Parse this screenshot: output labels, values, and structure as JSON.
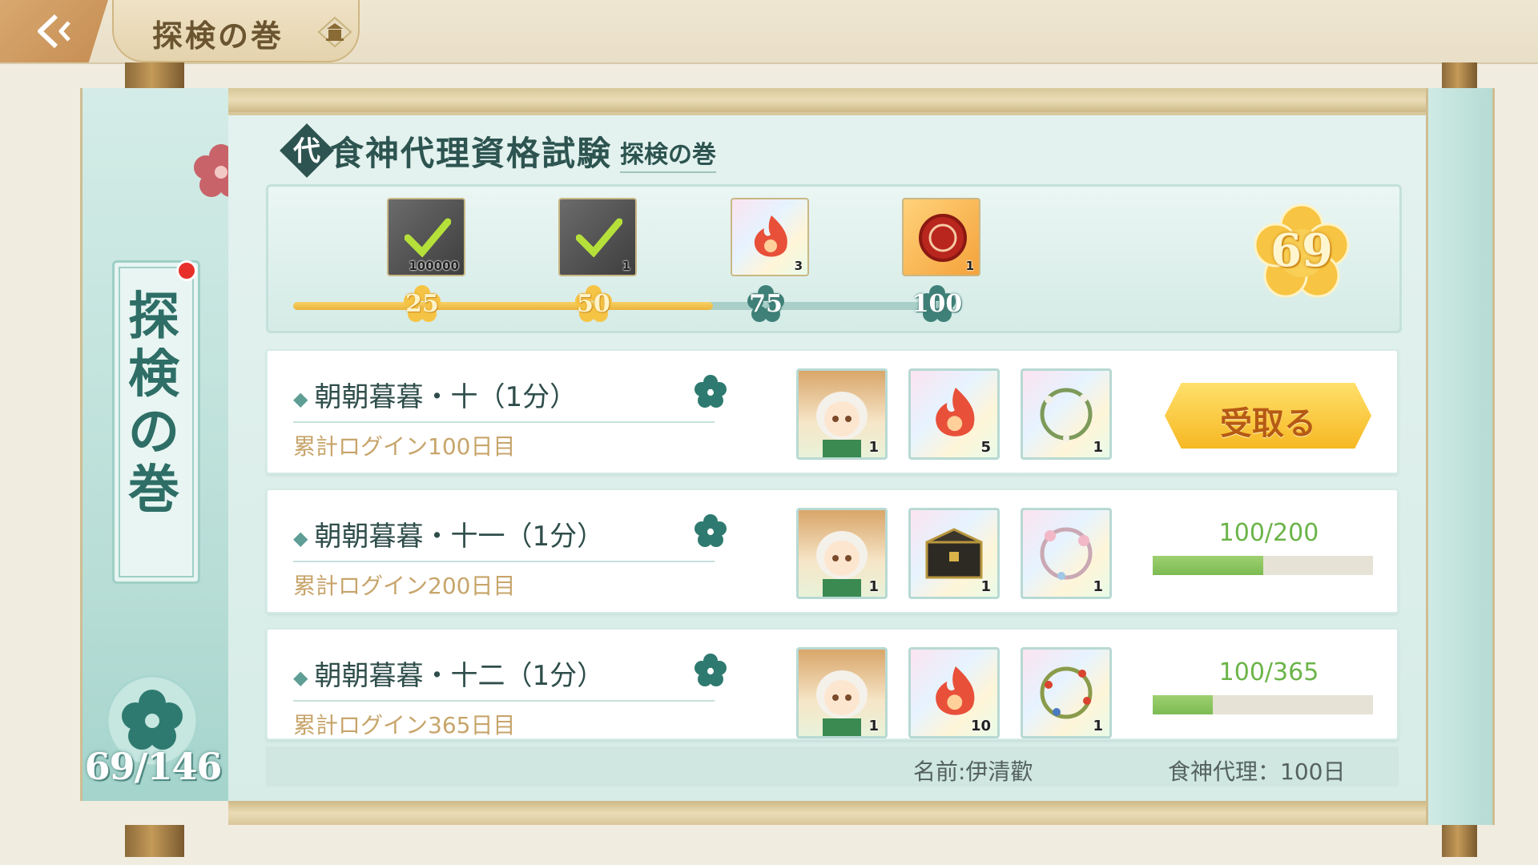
{
  "header": {
    "title": "探検の巻"
  },
  "left_panel": {
    "label": "探検の巻",
    "count": "69/146"
  },
  "section": {
    "badge": "代",
    "title": "食神代理資格試験",
    "subtitle": "探検の巻"
  },
  "progress": {
    "points": "69",
    "fraction": 0.69,
    "milestones": [
      {
        "value": "25",
        "qty": "100000",
        "claimed": true,
        "icon": "pouch-icon"
      },
      {
        "value": "50",
        "qty": "1",
        "claimed": true,
        "icon": "ember-icon"
      },
      {
        "value": "75",
        "qty": "3",
        "claimed": false,
        "icon": "ember-icon"
      },
      {
        "value": "100",
        "qty": "1",
        "claimed": false,
        "icon": "seal-icon"
      }
    ]
  },
  "tasks": [
    {
      "title": "朝朝暮暮・十（1分）",
      "subtitle": "累計ログイン100日目",
      "rewards": [
        {
          "icon": "character-icon",
          "qty": "1"
        },
        {
          "icon": "ember-icon",
          "qty": "5"
        },
        {
          "icon": "wreath-icon",
          "qty": "1"
        }
      ],
      "status": "claim",
      "claim_label": "受取る"
    },
    {
      "title": "朝朝暮暮・十一（1分）",
      "subtitle": "累計ログイン200日目",
      "rewards": [
        {
          "icon": "character-icon",
          "qty": "1"
        },
        {
          "icon": "chest-icon",
          "qty": "1"
        },
        {
          "icon": "flower-wreath-icon",
          "qty": "1"
        }
      ],
      "status": "progress",
      "progress_text": "100/200",
      "progress_fraction": 0.5
    },
    {
      "title": "朝朝暮暮・十二（1分）",
      "subtitle": "累計ログイン365日目",
      "rewards": [
        {
          "icon": "character-icon",
          "qty": "1"
        },
        {
          "icon": "ember-icon",
          "qty": "10"
        },
        {
          "icon": "berry-wreath-icon",
          "qty": "1"
        }
      ],
      "status": "progress",
      "progress_text": "100/365",
      "progress_fraction": 0.274
    }
  ],
  "footer": {
    "name": "名前:伊清歡",
    "proxy": "食神代理：100日"
  },
  "colors": {
    "accent_teal": "#2e6e66",
    "gold": "#f6b823",
    "progress_green": "#7cbb52"
  }
}
